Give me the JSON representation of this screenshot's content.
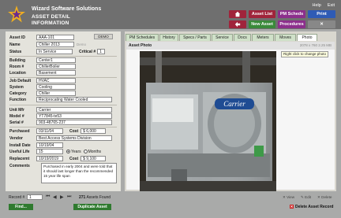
{
  "header": {
    "company": "Wizard Software Solutions",
    "title_line1": "ASSET DETAIL",
    "title_line2": "INFORMATION",
    "links": [
      "Help",
      "Exit"
    ],
    "buttons": {
      "home_icon": "home-icon",
      "back_icon": "back-arrow-icon",
      "asset_list": "Asset List",
      "new_asset": "New Asset",
      "pm_scheds": "PM Scheds",
      "procedures": "Procedures",
      "print": "Print",
      "x": "✕"
    }
  },
  "form": {
    "demo_label": "DEMO",
    "asset_id_label": "Asset ID",
    "asset_id": "AAA-101",
    "name_label": "Name",
    "name": "Chiller 2013",
    "name_hint": "Demo",
    "status_label": "Status",
    "status": "In Service",
    "critical_label": "Critical #",
    "critical": "1",
    "building_label": "Building",
    "building": "Center1",
    "room_label": "Room #",
    "room": "ChillerBoiler",
    "location_label": "Location",
    "location": "Basement",
    "job_default_label": "Job Default",
    "job_default": "HVAC",
    "system_label": "System",
    "system": "Cooling",
    "category_label": "Category",
    "category": "Chiller",
    "function_label": "Function",
    "function": "Reciprocating Water Cooled",
    "unit_mfr_label": "Unit Mfr",
    "unit_mfr": "Carrier",
    "model_label": "Model #",
    "model": "YT7845-te53",
    "serial_label": "Serial #",
    "serial": "903-48765-237",
    "purchased_label": "Purchased",
    "purchased": "03/11/04",
    "cost_label": "Cost",
    "cost": "$ 6,000",
    "vendor_label": "Vendor",
    "vendor": "Best Access Systems Division",
    "install_label": "Install Date",
    "install": "10/19/04",
    "useful_label": "Useful Life",
    "useful": "15",
    "years_label": "Years",
    "months_label": "Months",
    "replacement_label": "Replacemt",
    "replacement": "10/19/2019",
    "cost2_label": "Cost",
    "cost2": "$ 9,100",
    "comments_label": "Comments",
    "comments": "Purchased in early 2004 and were told that it should last longer than the recommended 15 year life span"
  },
  "tabs": [
    "PM Schedules",
    "History",
    "Specs / Parts",
    "Service",
    "Docs",
    "Meters",
    "Moves",
    "Photo"
  ],
  "photo": {
    "title": "Asset Photo",
    "size": "2078 x 760   2.25 MB",
    "tooltip": "Right click to change photo",
    "brand": "Carrier"
  },
  "footer": {
    "record_label": "Record #",
    "record": "1",
    "found_count": "271",
    "found_text": "Assets Found",
    "view": "View",
    "edit": "Edit",
    "delete_small": "Delete",
    "find": "Find...",
    "duplicate": "Duplicate Asset",
    "delete_record": "Delete Asset Record"
  }
}
